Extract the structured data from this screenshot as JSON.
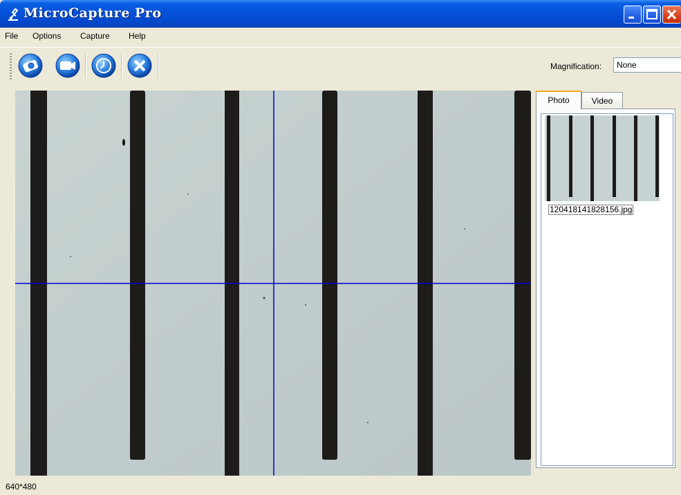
{
  "window": {
    "title": "MicroCapture Pro",
    "icon": "microscope-icon",
    "controls": [
      "minimize-icon",
      "maximize-icon",
      "close-icon"
    ]
  },
  "menu": {
    "items": [
      {
        "label": "File"
      },
      {
        "label": "Options"
      },
      {
        "label": "Capture"
      },
      {
        "label": "Help"
      }
    ]
  },
  "toolbar": {
    "buttons": [
      {
        "icon": "photo-capture-icon"
      },
      {
        "icon": "video-record-icon"
      },
      {
        "icon": "timer-icon"
      },
      {
        "icon": "exit-icon"
      }
    ],
    "magnification_label": "Magnification:",
    "magnification_value": "None"
  },
  "viewer": {
    "crosshair_color": "#0000cc"
  },
  "side_panel": {
    "tabs": [
      {
        "label": "Photo",
        "active": true
      },
      {
        "label": "Video",
        "active": false
      }
    ],
    "photos": [
      {
        "filename": "120418141828156.jpg"
      }
    ]
  },
  "status": {
    "resolution": "640*480"
  },
  "colors": {
    "titlebar": "#0551d8",
    "window_bg": "#ece9d8",
    "tab_highlight": "#f5a623",
    "button_blue": "#2a6fd6"
  }
}
